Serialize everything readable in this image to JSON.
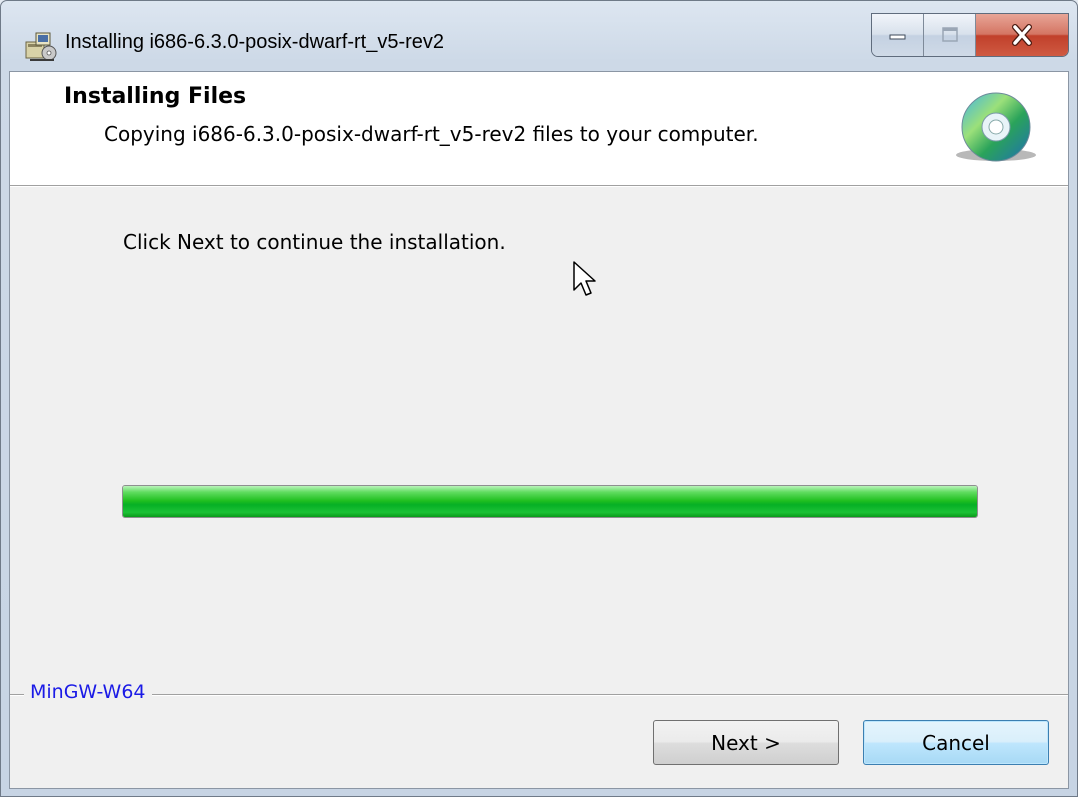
{
  "window": {
    "title": "Installing i686-6.3.0-posix-dwarf-rt_v5-rev2",
    "icons": {
      "app": "installer-icon",
      "minimize": "minimize-icon",
      "maximize": "maximize-icon",
      "close": "close-icon"
    }
  },
  "header": {
    "title": "Installing Files",
    "subtitle": "Copying i686-6.3.0-posix-dwarf-rt_v5-rev2 files to your computer.",
    "icon": "cd-disc-icon"
  },
  "body": {
    "instruction": "Click Next to continue the installation.",
    "progress_percent": 100,
    "progress_color": "#06b025"
  },
  "footer": {
    "brand": "MinGW-W64",
    "brand_color": "#1a1ae6",
    "next_label": "Next >",
    "cancel_label": "Cancel"
  }
}
